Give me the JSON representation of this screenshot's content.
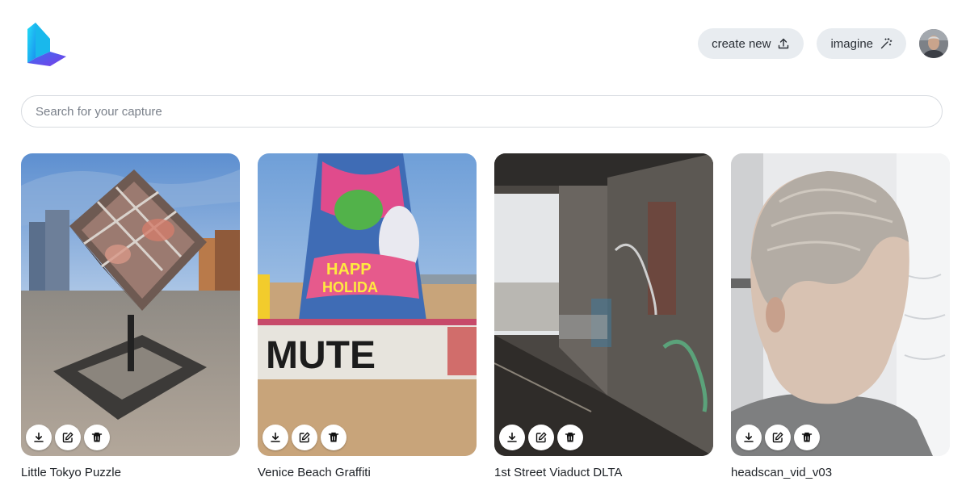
{
  "header": {
    "create_label": "create new",
    "imagine_label": "imagine"
  },
  "search": {
    "placeholder": "Search for your capture",
    "value": ""
  },
  "captures": [
    {
      "title": "Little Tokyo Puzzle"
    },
    {
      "title": "Venice Beach Graffiti"
    },
    {
      "title": "1st Street Viaduct DLTA"
    },
    {
      "title": "headscan_vid_v03"
    }
  ],
  "colors": {
    "pill_bg": "#e8ecf0",
    "logo_cyan": "#1fd1f0",
    "logo_purple": "#6a3de8"
  }
}
